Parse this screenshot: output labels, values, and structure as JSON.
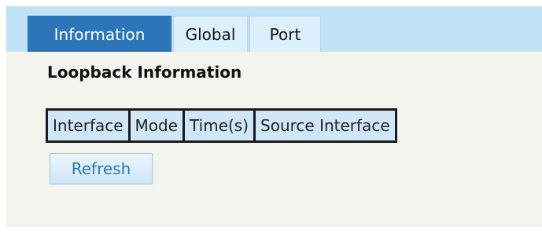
{
  "tabs": [
    {
      "label": "Information",
      "active": true
    },
    {
      "label": "Global",
      "active": false
    },
    {
      "label": "Port",
      "active": false
    }
  ],
  "section": {
    "title": "Loopback Information"
  },
  "table": {
    "columns": [
      "Interface",
      "Mode",
      "Time(s)",
      "Source Interface"
    ],
    "rows": []
  },
  "buttons": {
    "refresh_label": "Refresh"
  },
  "colors": {
    "tab_active_bg": "#2d75b9",
    "tab_bar_bg": "#c1e2f4",
    "panel_bg": "#f4f4ee",
    "table_header_bg": "#cfe7f6"
  }
}
